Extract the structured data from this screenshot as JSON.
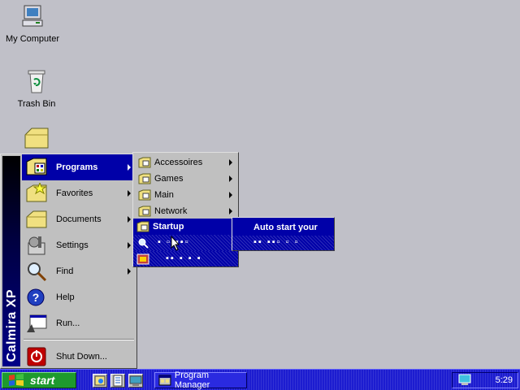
{
  "desktop": {
    "icons": [
      {
        "label": "My Computer",
        "icon": "my-computer-icon"
      },
      {
        "label": "Trash Bin",
        "icon": "recycle-bin-icon"
      },
      {
        "label": "",
        "icon": "folder-icon"
      }
    ]
  },
  "start_menu": {
    "banner": "Calmira XP",
    "items": [
      {
        "label": "Programs",
        "icon": "programs-icon",
        "has_submenu": true
      },
      {
        "label": "Favorites",
        "icon": "favorites-folder-icon",
        "has_submenu": true
      },
      {
        "label": "Documents",
        "icon": "documents-folder-icon",
        "has_submenu": true
      },
      {
        "label": "Settings",
        "icon": "settings-icon",
        "has_submenu": true
      },
      {
        "label": "Find",
        "icon": "find-icon",
        "has_submenu": true
      },
      {
        "label": "Help",
        "icon": "help-icon",
        "has_submenu": false
      },
      {
        "label": "Run...",
        "icon": "run-icon",
        "has_submenu": false
      },
      {
        "label": "Shut Down...",
        "icon": "shutdown-icon",
        "has_submenu": false
      }
    ]
  },
  "programs_menu": {
    "items": [
      {
        "label": "Accessoires",
        "has_submenu": true
      },
      {
        "label": "Games",
        "has_submenu": true
      },
      {
        "label": "Main",
        "has_submenu": true
      },
      {
        "label": "Network",
        "has_submenu": true
      },
      {
        "label": "Startup",
        "has_submenu": true
      },
      {
        "label": "▪ ▫ ▪▪▫",
        "has_submenu": false
      },
      {
        "label": "▪▪ ▪ ▪ ▪",
        "has_submenu": false
      }
    ]
  },
  "startup_menu": {
    "items": [
      {
        "label": "Auto start your"
      },
      {
        "label": "▪▪ ▪▪▫ ▫ ▫"
      }
    ]
  },
  "taskbar": {
    "start_label": "start",
    "tasks": [
      {
        "label": "Program Manager"
      }
    ],
    "clock": "5:29"
  },
  "colors": {
    "desktop": "#c0c0c8",
    "menu_highlight": "#0000a8",
    "taskbar": "#1c1cd0",
    "start_button": "#1e9a2e"
  }
}
